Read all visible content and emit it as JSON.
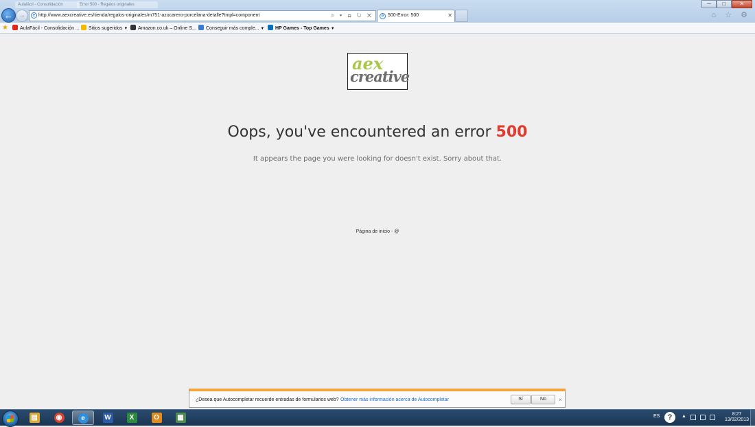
{
  "browser": {
    "ghost_tabs": [
      "Aulafácil - Consolidación",
      "Error 500 - Regalos originales"
    ],
    "address_url": "http://www.aexcreative.es/tienda/regalos-originales/m751-azucarero-porcelana-detalle?tmpl=component",
    "active_tab_title": "500-Error: 500",
    "address_tools": "⌕ ▾ ⊟ ↻ ✕",
    "window_buttons": {
      "minimize": "─",
      "maximize": "□",
      "close": "✕"
    },
    "right_icons": "⌂ ☆ ⚙"
  },
  "favorites": [
    {
      "label": "AulaFácil - Consolidación ...",
      "color": "#e0261b",
      "has_menu": false
    },
    {
      "label": "Sitios sugeridos",
      "color": "#f6b800",
      "has_menu": true
    },
    {
      "label": "Amazon.co.uk – Online S...",
      "color": "#333333",
      "has_menu": false
    },
    {
      "label": "Conseguir más comple...",
      "color": "#3a7bd5",
      "has_menu": true
    },
    {
      "label": "HP Games - Top Games",
      "color": "#0a6fb8",
      "has_menu": true
    }
  ],
  "page": {
    "logo_top": "aex",
    "logo_bottom": "creative",
    "headline_text": "Oops, you've encountered an error",
    "headline_code": "500",
    "subtext": "It appears the page you were looking for doesn't exist. Sorry about that.",
    "footer_link": "Página de inicio - @"
  },
  "autocomplete": {
    "question": "¿Desea que Autocompletar recuerde entradas de formularios web?",
    "more_info": "Obtener más información acerca de Autocompletar",
    "yes": "Sí",
    "no": "No",
    "close": "×"
  },
  "taskbar": {
    "apps": [
      {
        "name": "explorer",
        "glyph": "▤",
        "color": "#d9a93a",
        "active": false
      },
      {
        "name": "chrome",
        "glyph": "◉",
        "color": "#d9432f",
        "active": false
      },
      {
        "name": "internet-explorer",
        "glyph": "e",
        "color": "#2f8fe0",
        "active": true
      },
      {
        "name": "word",
        "glyph": "W",
        "color": "#2b5aa8",
        "active": false
      },
      {
        "name": "excel",
        "glyph": "X",
        "color": "#2e8a3f",
        "active": false
      },
      {
        "name": "outlook",
        "glyph": "O",
        "color": "#e38a1c",
        "active": false
      },
      {
        "name": "app",
        "glyph": "▦",
        "color": "#4f8a4f",
        "active": false
      }
    ],
    "lang": "ES",
    "help": "?",
    "tray_up": "▲",
    "time": "8:27",
    "date": "13/02/2013"
  }
}
